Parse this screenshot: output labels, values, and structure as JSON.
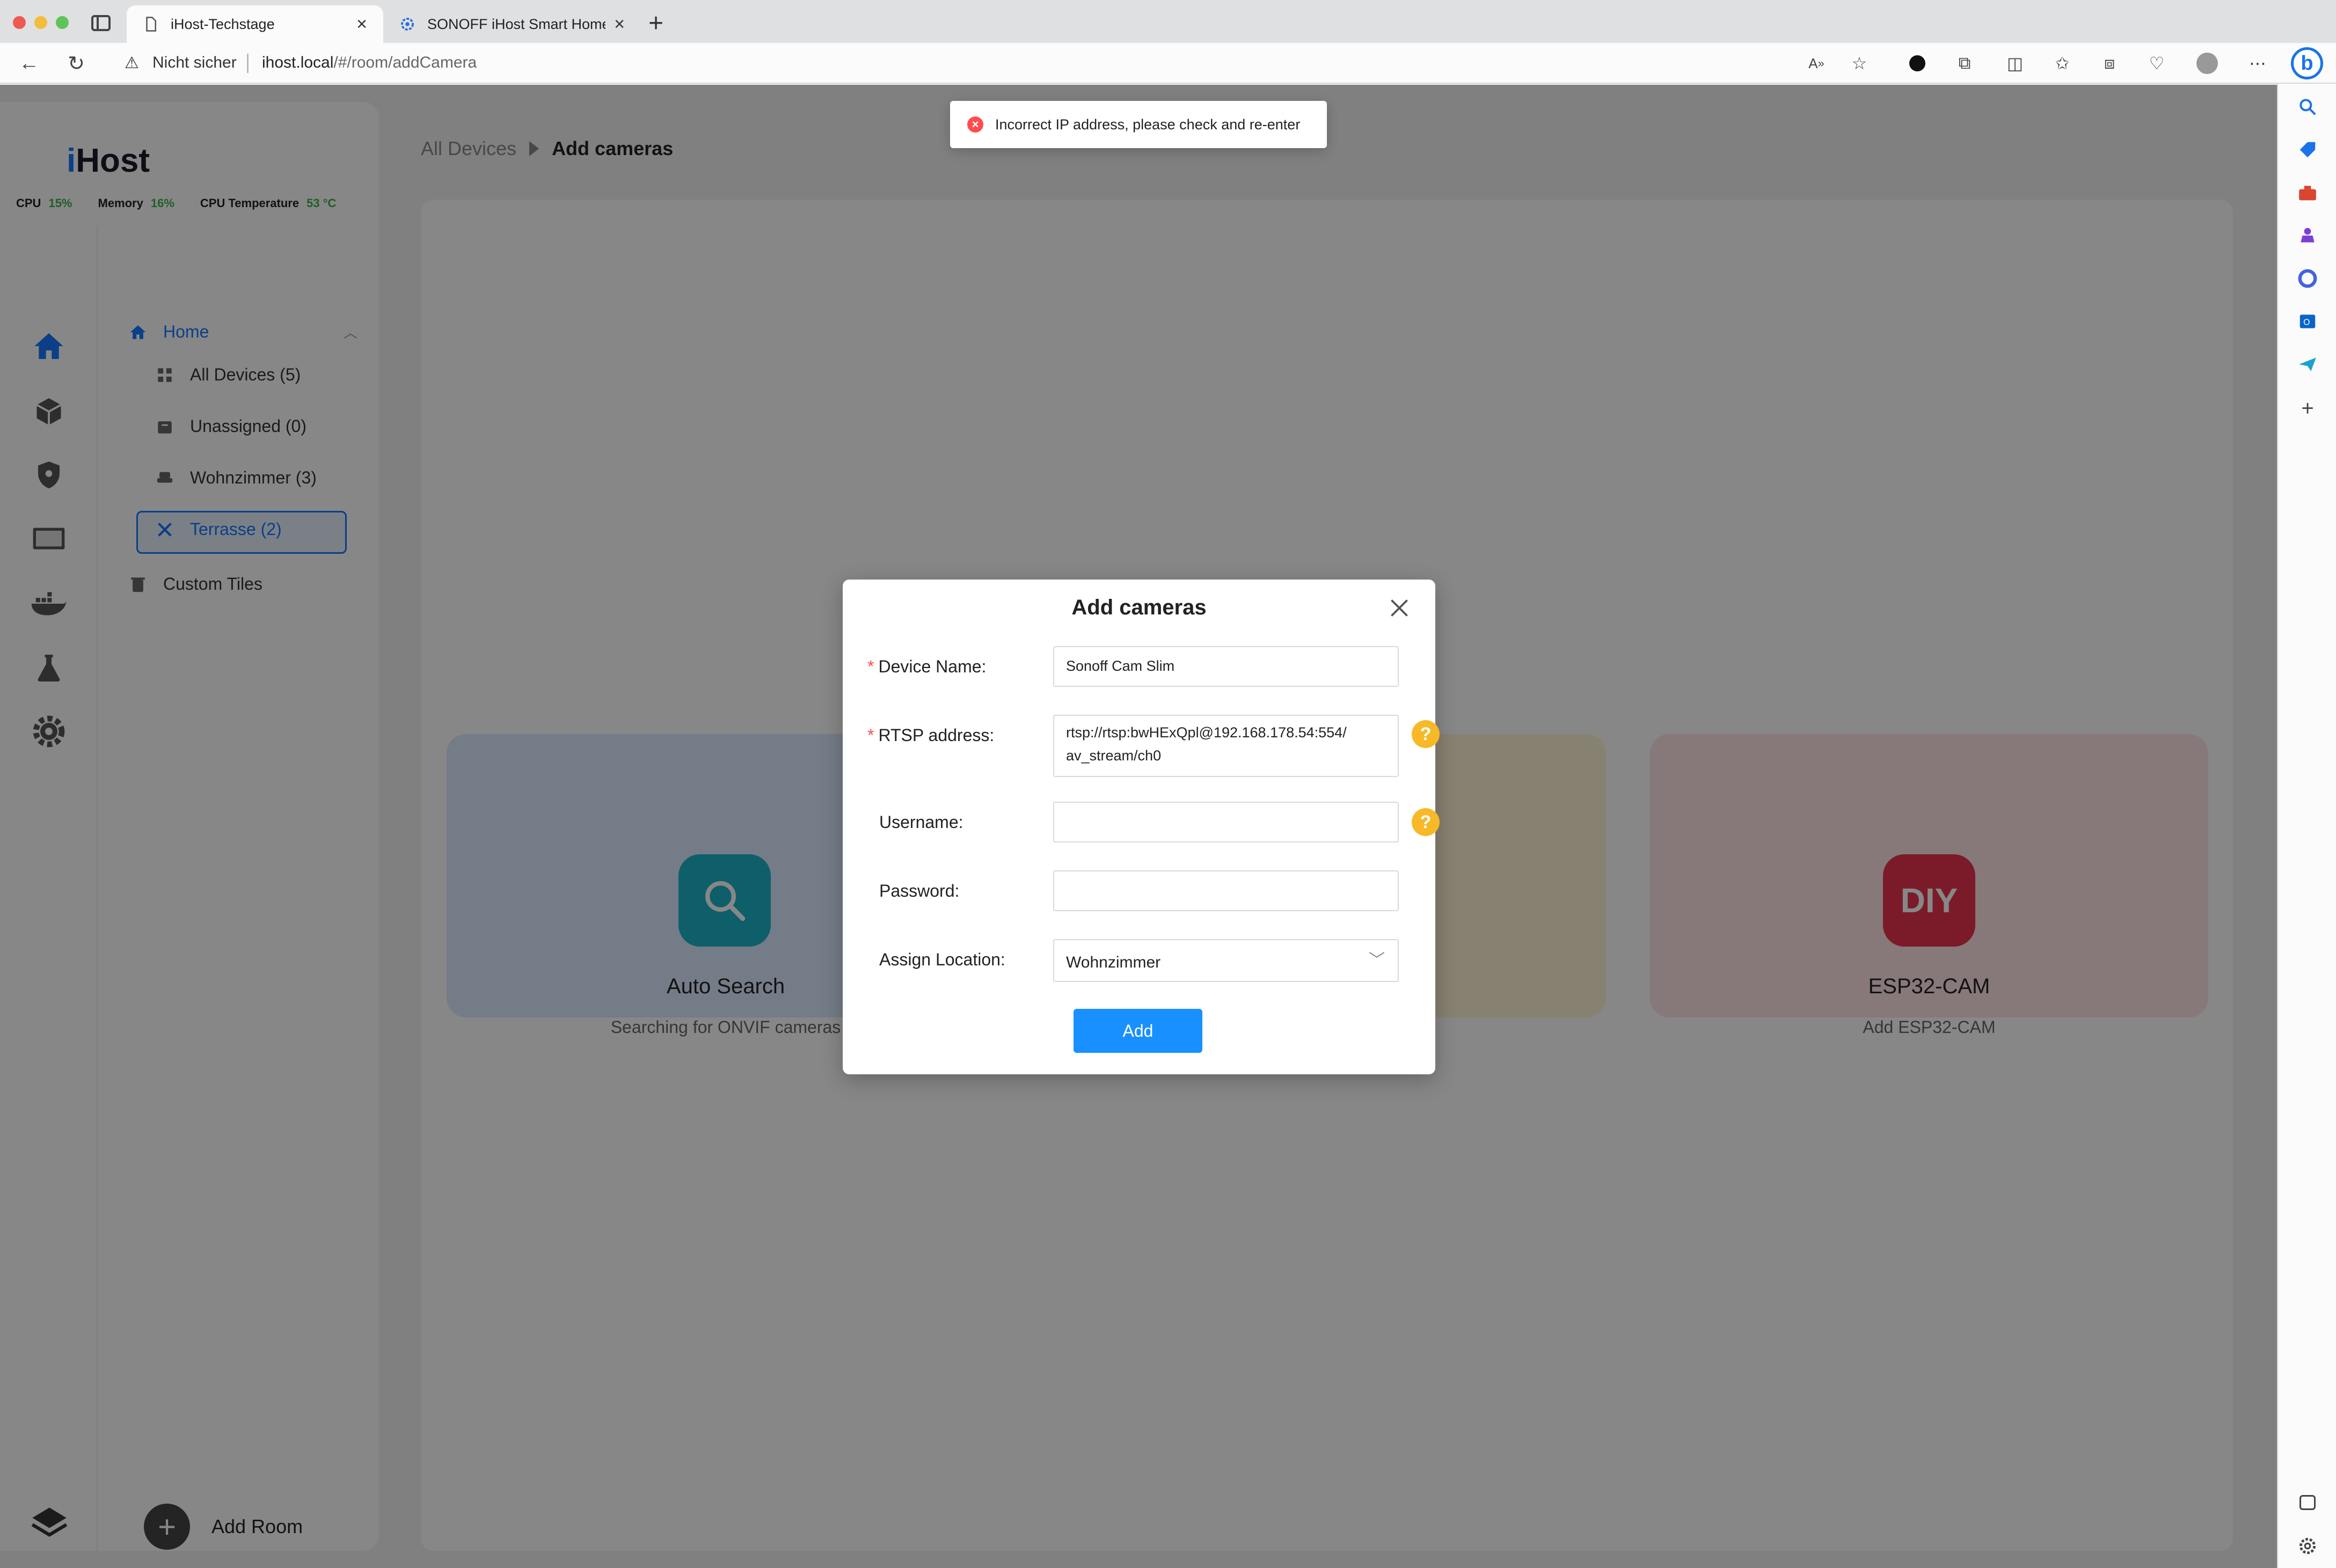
{
  "browser": {
    "tabs": [
      {
        "title": "iHost-Techstage",
        "active": true
      },
      {
        "title": "SONOFF iHost Smart Home Hub",
        "active": false
      }
    ],
    "address_bar": {
      "security_label": "Nicht sicher",
      "url_host": "ihost.local",
      "url_path": "/#/room/addCamera"
    }
  },
  "app": {
    "brand_prefix": "i",
    "brand_name": "Host",
    "stats": {
      "cpu_label": "CPU",
      "cpu_value": "15%",
      "memory_label": "Memory",
      "memory_value": "16%",
      "temp_label": "CPU Temperature",
      "temp_value": "53 °C"
    },
    "nav": {
      "home": "Home",
      "items": [
        {
          "label": "All Devices  (5)",
          "icon": "grid-icon"
        },
        {
          "label": "Unassigned  (0)",
          "icon": "box-icon"
        },
        {
          "label": "Wohnzimmer  (3)",
          "icon": "sofa-icon"
        },
        {
          "label": "Terrasse  (2)",
          "icon": "tools-icon",
          "active": true
        }
      ],
      "custom_tiles": "Custom Tiles",
      "add_room": "Add Room"
    },
    "rail_icons": [
      "home-icon",
      "cube-icon",
      "shield-icon",
      "monitor-icon",
      "docker-icon",
      "flask-icon",
      "gear-icon"
    ]
  },
  "breadcrumb": {
    "parent": "All Devices",
    "current": "Add cameras"
  },
  "cards": [
    {
      "title": "Auto Search",
      "subtitle": "Searching for ONVIF cameras",
      "icon": "search-icon",
      "color": "#1bb3c9"
    },
    {
      "title": "ESP32-CAM",
      "subtitle": "Add ESP32-CAM",
      "icon_text": "DIY",
      "color": "#e8334f"
    }
  ],
  "toast": {
    "message": "Incorrect IP address, please check and re-enter",
    "type": "error"
  },
  "modal": {
    "title": "Add cameras",
    "fields": {
      "device_name_label": "Device Name",
      "device_name_value": "Sonoff Cam Slim",
      "rtsp_label": "RTSP address",
      "rtsp_value": "rtsp://rtsp:bwHExQpl@192.168.178.54:554/\nav_stream/ch0",
      "username_label": "Username",
      "username_value": "",
      "password_label": "Password",
      "password_value": "",
      "location_label": "Assign Location",
      "location_value": "Wohnzimmer"
    },
    "add_button": "Add"
  },
  "colors": {
    "accent": "#1677ff",
    "button": "#1890ff",
    "error": "#ff4d4f",
    "help": "#f7b928",
    "stat_green": "#3bb34a"
  }
}
